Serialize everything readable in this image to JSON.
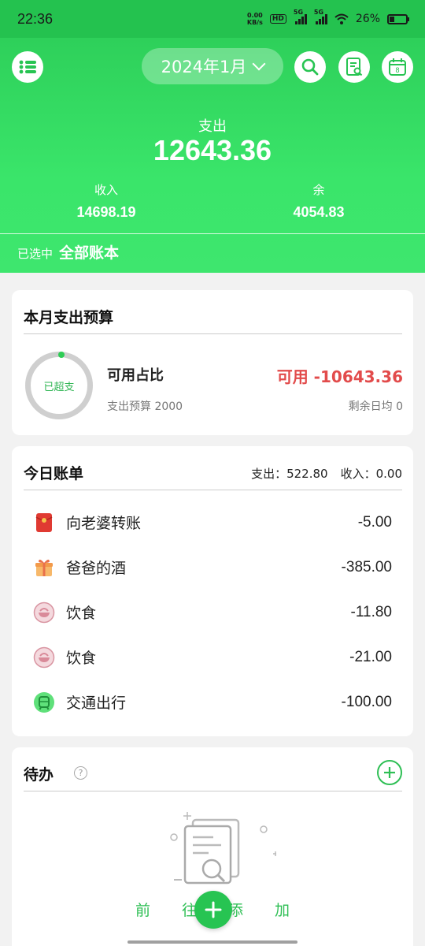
{
  "status_bar": {
    "time": "22:36",
    "net_speed_value": "0.00",
    "net_speed_unit": "KB/s",
    "hd_badge": "HD",
    "signal1_label": "5G",
    "signal2_label": "5G",
    "battery": "26%",
    "battery_level": 0.26
  },
  "header": {
    "month": "2024年1月",
    "expense_label": "支出",
    "expense_value": "12643.36",
    "income_label": "收入",
    "income_value": "14698.19",
    "balance_label": "余",
    "balance_value": "4054.83",
    "selected_label": "已选中",
    "selected_book": "全部账本",
    "icons": [
      "list-menu-icon",
      "search-icon",
      "bill-search-icon",
      "calendar-icon"
    ],
    "calendar_day": "8"
  },
  "budget": {
    "title": "本月支出预算",
    "ring_label": "已超支",
    "ratio_label": "可用占比",
    "budget_text": "支出预算 2000",
    "available_text": "可用 -10643.36",
    "daily_text": "剩余日均 0"
  },
  "today": {
    "title": "今日账单",
    "expense_summary": "支出：522.80",
    "income_summary": "收入：0.00",
    "items": [
      {
        "name": "向老婆转账",
        "amount": "-5.00",
        "icon": "red-envelope-icon"
      },
      {
        "name": "爸爸的酒",
        "amount": "-385.00",
        "icon": "gift-icon"
      },
      {
        "name": "饮食",
        "amount": "-11.80",
        "icon": "food-bowl-icon"
      },
      {
        "name": "饮食",
        "amount": "-21.00",
        "icon": "food-bowl-icon"
      },
      {
        "name": "交通出行",
        "amount": "-100.00",
        "icon": "transport-icon"
      }
    ]
  },
  "todo": {
    "title": "待办",
    "help_glyph": "?",
    "empty_text": "前往添加"
  },
  "colors": {
    "brand_green": "#2ed05a",
    "negative_red": "#e24b4b"
  }
}
